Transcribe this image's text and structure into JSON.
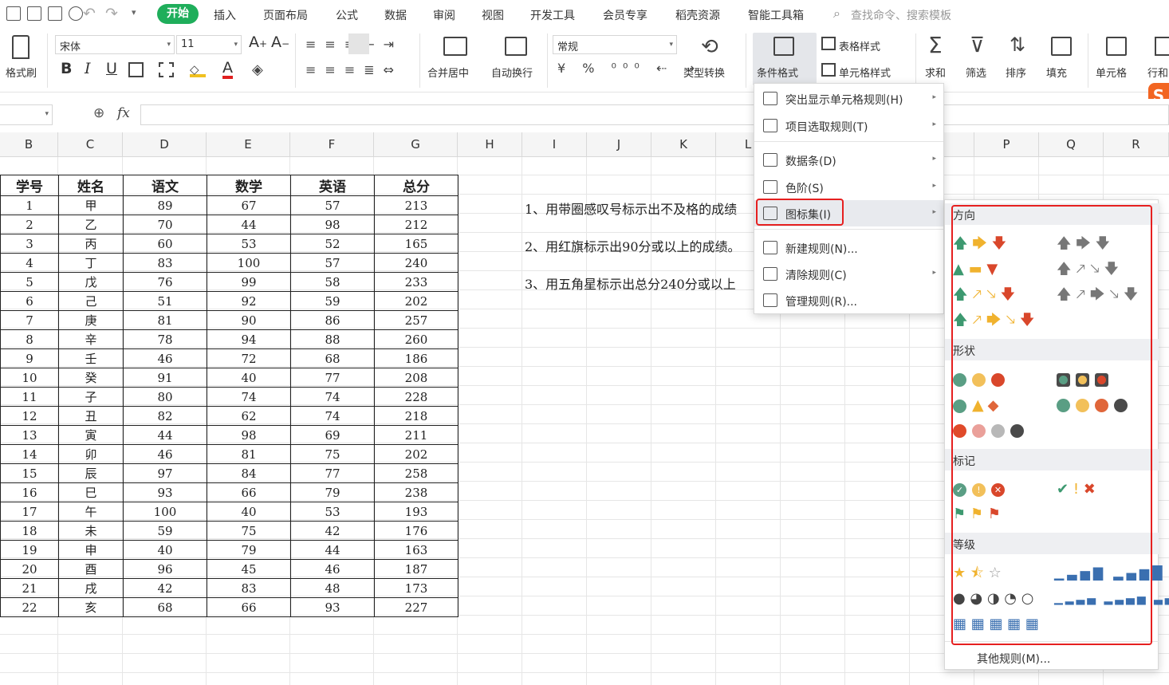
{
  "menubar": {
    "tabs": [
      "开始",
      "插入",
      "页面布局",
      "公式",
      "数据",
      "审阅",
      "视图",
      "开发工具",
      "会员专享",
      "稻壳资源",
      "智能工具箱"
    ],
    "search_placeholder": "查找命令、搜索模板"
  },
  "ribbon": {
    "format_painter": "格式刷",
    "font_name": "宋体",
    "font_size": "11",
    "merge_center": "合并居中",
    "wrap_text": "自动换行",
    "number_format": "常规",
    "type_convert": "类型转换",
    "conditional_format": "条件格式",
    "table_style": "表格样式",
    "cell_style": "单元格样式",
    "sum": "求和",
    "filter": "筛选",
    "sort": "排序",
    "fill": "填充",
    "cell": "单元格",
    "row_col": "行和"
  },
  "formula_bar": {
    "fx": "fx",
    "value": ""
  },
  "columns": [
    "B",
    "C",
    "D",
    "E",
    "F",
    "G",
    "H",
    "I",
    "J",
    "K",
    "L",
    "O",
    "P",
    "Q",
    "R"
  ],
  "table": {
    "headers": [
      "学号",
      "姓名",
      "语文",
      "数学",
      "英语",
      "总分"
    ],
    "rows": [
      [
        "1",
        "甲",
        "89",
        "67",
        "57",
        "213"
      ],
      [
        "2",
        "乙",
        "70",
        "44",
        "98",
        "212"
      ],
      [
        "3",
        "丙",
        "60",
        "53",
        "52",
        "165"
      ],
      [
        "4",
        "丁",
        "83",
        "100",
        "57",
        "240"
      ],
      [
        "5",
        "戊",
        "76",
        "99",
        "58",
        "233"
      ],
      [
        "6",
        "己",
        "51",
        "92",
        "59",
        "202"
      ],
      [
        "7",
        "庚",
        "81",
        "90",
        "86",
        "257"
      ],
      [
        "8",
        "辛",
        "78",
        "94",
        "88",
        "260"
      ],
      [
        "9",
        "壬",
        "46",
        "72",
        "68",
        "186"
      ],
      [
        "10",
        "癸",
        "91",
        "40",
        "77",
        "208"
      ],
      [
        "11",
        "子",
        "80",
        "74",
        "74",
        "228"
      ],
      [
        "12",
        "丑",
        "82",
        "62",
        "74",
        "218"
      ],
      [
        "13",
        "寅",
        "44",
        "98",
        "69",
        "211"
      ],
      [
        "14",
        "卯",
        "46",
        "81",
        "75",
        "202"
      ],
      [
        "15",
        "辰",
        "97",
        "84",
        "77",
        "258"
      ],
      [
        "16",
        "巳",
        "93",
        "66",
        "79",
        "238"
      ],
      [
        "17",
        "午",
        "100",
        "40",
        "53",
        "193"
      ],
      [
        "18",
        "未",
        "59",
        "75",
        "42",
        "176"
      ],
      [
        "19",
        "申",
        "40",
        "79",
        "44",
        "163"
      ],
      [
        "20",
        "酉",
        "96",
        "45",
        "46",
        "187"
      ],
      [
        "21",
        "戌",
        "42",
        "83",
        "48",
        "173"
      ],
      [
        "22",
        "亥",
        "68",
        "66",
        "93",
        "227"
      ]
    ]
  },
  "notes": [
    "1、用带圈感叹号标示出不及格的成绩",
    "2、用红旗标示出90分或以上的成绩。",
    "3、用五角星标示出总分240分或以上"
  ],
  "cf_menu": {
    "items": [
      {
        "label": "突出显示单元格规则(H)"
      },
      {
        "label": "项目选取规则(T)"
      },
      {
        "label": "数据条(D)"
      },
      {
        "label": "色阶(S)"
      },
      {
        "label": "图标集(I)"
      },
      {
        "label": "新建规则(N)..."
      },
      {
        "label": "清除规则(C)"
      },
      {
        "label": "管理规则(R)..."
      }
    ]
  },
  "iconset_menu": {
    "sections": [
      "方向",
      "形状",
      "标记",
      "等级"
    ],
    "more": "其他规则(M)..."
  },
  "colors": {
    "accent": "#1fae5b",
    "highlight_box": "#e62020",
    "green": "#3d9970",
    "yellow": "#f0b22e",
    "red": "#d9472b"
  }
}
